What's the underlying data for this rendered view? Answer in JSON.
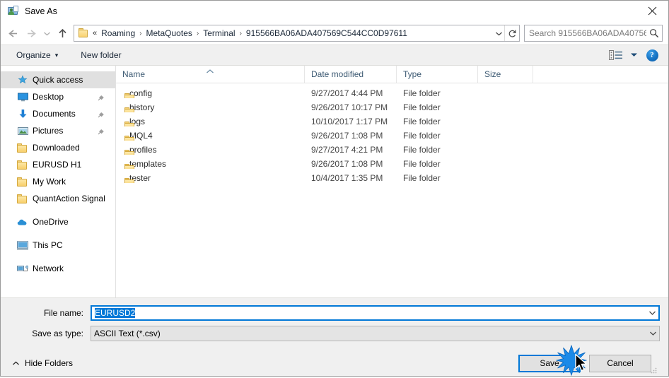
{
  "window": {
    "title": "Save As",
    "icon": "save-as-folder-person-icon",
    "close_label": "✕"
  },
  "navigation": {
    "back_title": "Back",
    "forward_title": "Forward",
    "recent_title": "Recent locations",
    "up_title": "Up",
    "breadcrumb_lead": "«",
    "breadcrumbs": [
      "Roaming",
      "MetaQuotes",
      "Terminal",
      "915566BA06ADA407569C544CC0D97611"
    ],
    "separator": "›",
    "refresh_title": "Refresh"
  },
  "search": {
    "placeholder": "Search 915566BA06ADA40756...",
    "icon": "search-icon"
  },
  "toolbar": {
    "organize_label": "Organize",
    "organize_caret": "▾",
    "new_folder_label": "New folder",
    "view_icon": "view-options-icon",
    "view_caret": "▾",
    "help_label": "?"
  },
  "sidebar": {
    "groups": [
      {
        "items": [
          {
            "label": "Quick access",
            "icon": "star-icon",
            "selected": true,
            "pinned": false,
            "indent": 0
          },
          {
            "label": "Desktop",
            "icon": "desktop-icon",
            "selected": false,
            "pinned": true,
            "indent": 1
          },
          {
            "label": "Documents",
            "icon": "documents-download-icon",
            "selected": false,
            "pinned": true,
            "indent": 1
          },
          {
            "label": "Pictures",
            "icon": "pictures-icon",
            "selected": false,
            "pinned": true,
            "indent": 1
          },
          {
            "label": "Downloaded",
            "icon": "folder-icon",
            "selected": false,
            "pinned": false,
            "indent": 1
          },
          {
            "label": "EURUSD H1",
            "icon": "folder-icon",
            "selected": false,
            "pinned": false,
            "indent": 1
          },
          {
            "label": "My Work",
            "icon": "folder-icon",
            "selected": false,
            "pinned": false,
            "indent": 1
          },
          {
            "label": "QuantAction Signal",
            "icon": "folder-icon",
            "selected": false,
            "pinned": false,
            "indent": 1
          }
        ]
      },
      {
        "items": [
          {
            "label": "OneDrive",
            "icon": "onedrive-cloud-icon",
            "selected": false,
            "pinned": false,
            "indent": 0
          }
        ]
      },
      {
        "items": [
          {
            "label": "This PC",
            "icon": "this-pc-icon",
            "selected": false,
            "pinned": false,
            "indent": 0
          }
        ]
      },
      {
        "items": [
          {
            "label": "Network",
            "icon": "network-icon",
            "selected": false,
            "pinned": false,
            "indent": 0
          }
        ]
      }
    ]
  },
  "filelist": {
    "columns": [
      {
        "key": "name",
        "label": "Name",
        "sorted": "asc"
      },
      {
        "key": "date",
        "label": "Date modified",
        "sorted": ""
      },
      {
        "key": "type",
        "label": "Type",
        "sorted": ""
      },
      {
        "key": "size",
        "label": "Size",
        "sorted": ""
      }
    ],
    "rows": [
      {
        "name": "config",
        "date": "9/27/2017 4:44 PM",
        "type": "File folder",
        "size": ""
      },
      {
        "name": "history",
        "date": "9/26/2017 10:17 PM",
        "type": "File folder",
        "size": ""
      },
      {
        "name": "logs",
        "date": "10/10/2017 1:17 PM",
        "type": "File folder",
        "size": ""
      },
      {
        "name": "MQL4",
        "date": "9/26/2017 1:08 PM",
        "type": "File folder",
        "size": ""
      },
      {
        "name": "profiles",
        "date": "9/27/2017 4:21 PM",
        "type": "File folder",
        "size": ""
      },
      {
        "name": "templates",
        "date": "9/26/2017 1:08 PM",
        "type": "File folder",
        "size": ""
      },
      {
        "name": "tester",
        "date": "10/4/2017 1:35 PM",
        "type": "File folder",
        "size": ""
      }
    ]
  },
  "form": {
    "filename_label": "File name:",
    "filename_value": "EURUSD2",
    "filename_selected": true,
    "savetype_label": "Save as type:",
    "savetype_value": "ASCII Text (*.csv)"
  },
  "actions": {
    "hide_folders_label": "Hide Folders",
    "hide_folders_caret": "⌃",
    "save_label": "Save",
    "cancel_label": "Cancel"
  },
  "colors": {
    "accent": "#0078d7",
    "selection": "#0078d7",
    "toolbar_bg": "#f0f0f0",
    "selected_row_bg": "#e0e0e0",
    "folder_yellow": "#f8cf6b",
    "header_text": "#3d5a73"
  },
  "pointer": {
    "click_indicator": "click-burst",
    "cursor": "arrow-cursor"
  }
}
